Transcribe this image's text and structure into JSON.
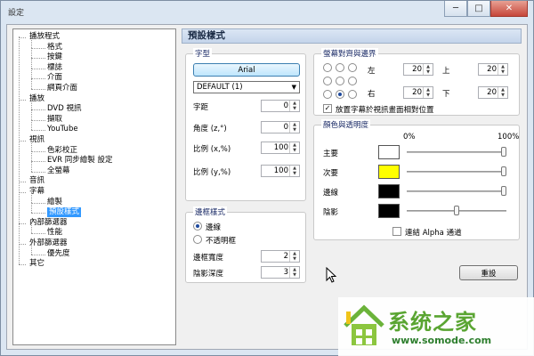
{
  "window": {
    "title": "設定",
    "buttons": {
      "minimize": "─",
      "maximize": "□",
      "close": "✕"
    }
  },
  "tree": [
    {
      "label": "播放程式",
      "level": 0
    },
    {
      "label": "格式",
      "level": 1
    },
    {
      "label": "按鍵",
      "level": 1
    },
    {
      "label": "標誌",
      "level": 1
    },
    {
      "label": "介面",
      "level": 1
    },
    {
      "label": "網頁介面",
      "level": 1
    },
    {
      "label": "播放",
      "level": 0
    },
    {
      "label": "DVD 視訊",
      "level": 1
    },
    {
      "label": "擷取",
      "level": 1
    },
    {
      "label": "YouTube",
      "level": 1
    },
    {
      "label": "視訊",
      "level": 0
    },
    {
      "label": "色彩校正",
      "level": 1
    },
    {
      "label": "EVR 同步繪製 設定",
      "level": 1
    },
    {
      "label": "全螢幕",
      "level": 1
    },
    {
      "label": "音訊",
      "level": 0
    },
    {
      "label": "字幕",
      "level": 0
    },
    {
      "label": "繪製",
      "level": 1
    },
    {
      "label": "預設樣式",
      "level": 1,
      "selected": true
    },
    {
      "label": "內部篩選器",
      "level": 0
    },
    {
      "label": "性能",
      "level": 1
    },
    {
      "label": "外部篩選器",
      "level": 0
    },
    {
      "label": "優先度",
      "level": 1
    },
    {
      "label": "其它",
      "level": 0
    }
  ],
  "panel": {
    "title": "預設樣式",
    "font": {
      "group": "字型",
      "font_button": "Arial",
      "charset": "DEFAULT (1)",
      "spacing_label": "字距",
      "spacing_value": "0",
      "angle_label": "角度 (z,°)",
      "angle_value": "0",
      "scale_x_label": "比例 (x,%)",
      "scale_x_value": "100",
      "scale_y_label": "比例 (y,%)",
      "scale_y_value": "100"
    },
    "border": {
      "group": "邊框樣式",
      "outline_label": "邊線",
      "opaque_label": "不透明框",
      "width_label": "邊框寬度",
      "width_value": "2",
      "shadow_label": "陰影深度",
      "shadow_value": "3"
    },
    "alignment": {
      "group": "螢幕對齊與邊界",
      "left_label": "左",
      "left_value": "20",
      "top_label": "上",
      "top_value": "20",
      "right_label": "右",
      "right_value": "20",
      "bottom_label": "下",
      "bottom_value": "20",
      "relative_label": "放置字幕於視訊畫面相對位置",
      "selected_position": "bottom-center"
    },
    "colors": {
      "group": "顏色與透明度",
      "min_label": "0%",
      "max_label": "100%",
      "rows": [
        {
          "label": "主要",
          "color": "#ffffff",
          "alpha_percent": 100
        },
        {
          "label": "次要",
          "color": "#ffff00",
          "alpha_percent": 100
        },
        {
          "label": "邊線",
          "color": "#000000",
          "alpha_percent": 100
        },
        {
          "label": "陰影",
          "color": "#000000",
          "alpha_percent": 50
        }
      ],
      "link_label": "連結 Alpha 通道"
    },
    "reset_button": "重設"
  },
  "watermark": {
    "name": "系统之家",
    "url": "www.somode.com"
  }
}
